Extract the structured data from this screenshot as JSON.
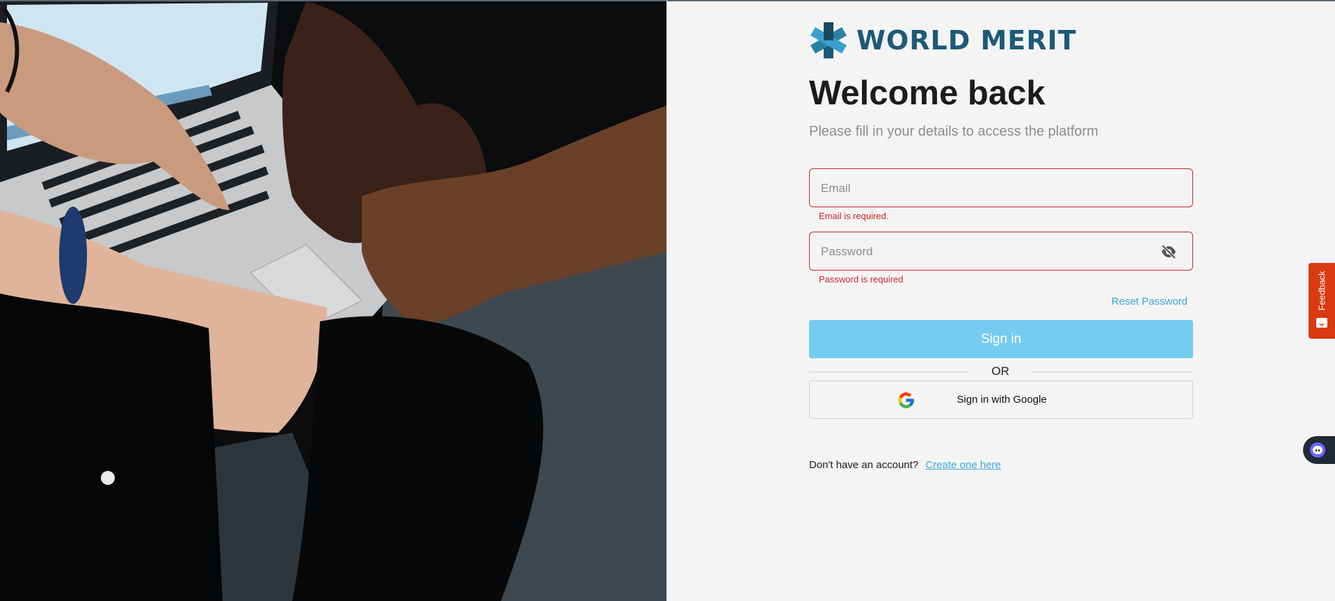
{
  "brand": {
    "name": "WORLD MERIT",
    "color": "#1d5a78"
  },
  "login": {
    "title": "Welcome back",
    "subtitle": "Please fill in your details to access the platform",
    "email_placeholder": "Email",
    "email_value": "",
    "email_error": "Email is required.",
    "password_placeholder": "Password",
    "password_value": "",
    "password_error": "Password is required",
    "reset_label": "Reset Password",
    "signin_label": "Sign in",
    "or_label": "OR",
    "google_label": "Sign in with Google",
    "account_prompt": "Don't have an account?",
    "create_label": "Create one here"
  },
  "widgets": {
    "feedback_label": "Feedback"
  },
  "colors": {
    "error": "#c62828",
    "link": "#3aa6d6",
    "primary_button": "#76ccf0",
    "feedback": "#d93a12"
  }
}
